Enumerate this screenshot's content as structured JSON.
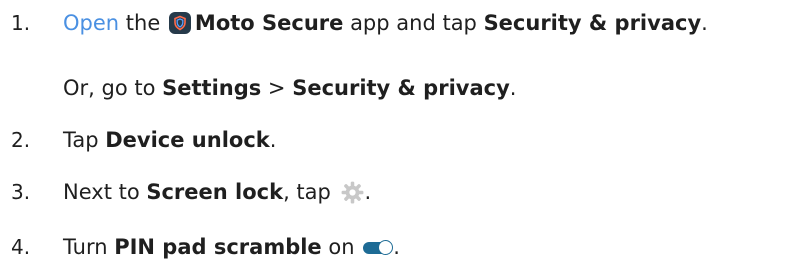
{
  "steps": [
    {
      "number": "1.",
      "link": "Open",
      "text_1": " the ",
      "app_name": "Moto Secure",
      "text_2": " app and tap ",
      "target": "Security & privacy",
      "text_3": "."
    },
    {
      "prefix": "Or, go to ",
      "settings": "Settings",
      "separator": " > ",
      "target": "Security & privacy",
      "suffix": "."
    },
    {
      "number": "2.",
      "prefix": "Tap ",
      "target": "Device unlock",
      "suffix": "."
    },
    {
      "number": "3.",
      "prefix": "Next to ",
      "target": "Screen lock",
      "text_2": ", tap ",
      "suffix": "."
    },
    {
      "number": "4.",
      "prefix": "Turn ",
      "target": "PIN pad scramble",
      "text_2": " on ",
      "suffix": "."
    }
  ],
  "icons": {
    "app": "moto-secure-app-icon",
    "settings": "gear-icon",
    "toggle": "toggle-on-icon"
  },
  "colors": {
    "link": "#4a90e2",
    "text": "#1f1f1f",
    "app_icon_bg": "#263a4a",
    "toggle_on": "#1d6b95",
    "gear": "#c8c8c8"
  }
}
